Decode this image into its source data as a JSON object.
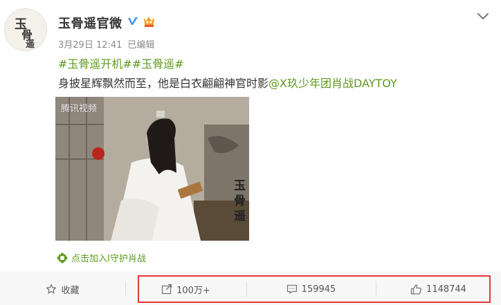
{
  "post": {
    "author": "玉骨遥官微",
    "timestamp": "3月29日 12:41",
    "edited": "已编辑",
    "tags": [
      "#玉骨遥开机#",
      "#玉骨遥#"
    ],
    "text": "身披星辉飘然而至，他是白衣翩翩神官时影",
    "mention": "@X玖少年团肖战DAYTOY",
    "avatar_glyphs": [
      "玉",
      "骨",
      "遥"
    ],
    "image": {
      "watermark": "腾讯视频",
      "side_title": "玉骨遥"
    },
    "supertopic": "点击加入I守护肖战"
  },
  "actions": {
    "favorite": "收藏",
    "repost": "100万+",
    "comments": "159945",
    "likes": "1148744"
  },
  "colors": {
    "accent_green": "#5f9a1e",
    "verified_blue": "#3b8ff3",
    "highlight_red": "#e53935"
  }
}
